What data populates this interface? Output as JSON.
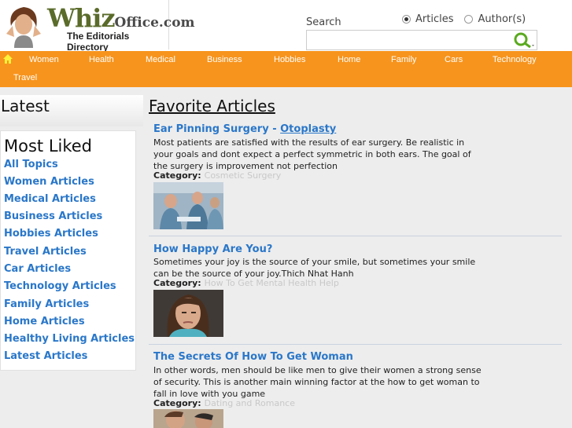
{
  "header": {
    "logo_whiz": "Whiz",
    "logo_office": "Office.com",
    "logo_tag": "The Editorials Directory",
    "search_label": "Search",
    "radio_articles": "Articles",
    "radio_authors": "Author(s)",
    "search_placeholder": ""
  },
  "nav": {
    "items": [
      "Women",
      "Health",
      "Medical",
      "Business",
      "Hobbies",
      "Home",
      "Family",
      "Cars",
      "Technology",
      "Travel"
    ]
  },
  "sidebar": {
    "latest": "Latest",
    "most_liked": "Most Liked",
    "links": [
      "All Topics",
      "Women Articles",
      "Medical Articles",
      "Business Articles",
      "Hobbies Articles",
      "Travel Articles",
      "Car Articles",
      "Technology Articles",
      "Family Articles",
      "Home Articles",
      "Healthy Living Articles",
      "Latest Articles"
    ]
  },
  "main": {
    "title": "Favorite Articles",
    "category_label": "Category:",
    "articles": [
      {
        "title": "Ear Pinning Surgery - ",
        "title_link": "Otoplasty",
        "body": "Most patients are satisfied with the results of ear surgery. Be realistic in your goals and dont expect a perfect symmetric in both ears. The goal of the surgery is improvement not perfection",
        "category": "Cosmetic Surgery"
      },
      {
        "title": "How Happy Are You?",
        "title_link": "",
        "body": "Sometimes your joy is the source of your smile, but sometimes your smile can be the source of your joy.Thich Nhat Hanh",
        "category": "How To Get Mental Health Help"
      },
      {
        "title": "The Secrets Of How To Get Woman",
        "title_link": "",
        "body": "In other words, men should be like men to give their women a strong sense of security. This is another main winning factor at the how to get woman to fall in love with you game",
        "category": "Dating and Romance"
      }
    ]
  },
  "colors": {
    "nav_bg": "#f7941d",
    "link": "#2a77c9",
    "category_value": "#c8c8c8"
  }
}
